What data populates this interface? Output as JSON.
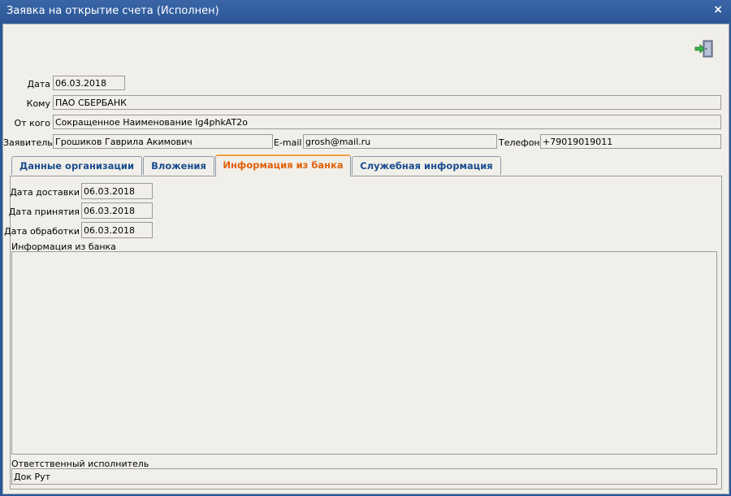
{
  "window": {
    "title": "Заявка на открытие счета (Исполнен)",
    "close_glyph": "×"
  },
  "header": {
    "date_label": "Дата",
    "date_value": "06.03.2018",
    "to_label": "Кому",
    "to_value": "ПАО СБЕРБАНК",
    "from_label": "От кого",
    "from_value": "Сокращенное Наименование Ig4phkAT2o",
    "applicant_label": "Заявитель",
    "applicant_value": "Грошиков Гаврила Акимович",
    "email_label": "E-mail",
    "email_value": "grosh@mail.ru",
    "phone_label": "Телефон",
    "phone_value": "+79019019011",
    "exit_icon": "exit-door-icon"
  },
  "tabs": [
    {
      "label": "Данные организации",
      "active": false
    },
    {
      "label": "Вложения",
      "active": false
    },
    {
      "label": "Информация из банка",
      "active": true
    },
    {
      "label": "Служебная информация",
      "active": false
    }
  ],
  "bank_info": {
    "delivery_label": "Дата доставки",
    "delivery_value": "06.03.2018",
    "accepted_label": "Дата принятия",
    "accepted_value": "06.03.2018",
    "processed_label": "Дата обработки",
    "processed_value": "06.03.2018",
    "info_label": "Информация из банка",
    "info_value": "",
    "executor_label": "Ответственный исполнитель",
    "executor_value": "Док Рут"
  },
  "colors": {
    "title_bar": "#2b5797",
    "active_tab_text": "#e0620a",
    "tab_text": "#1a4d8f",
    "background": "#f1efe9"
  }
}
